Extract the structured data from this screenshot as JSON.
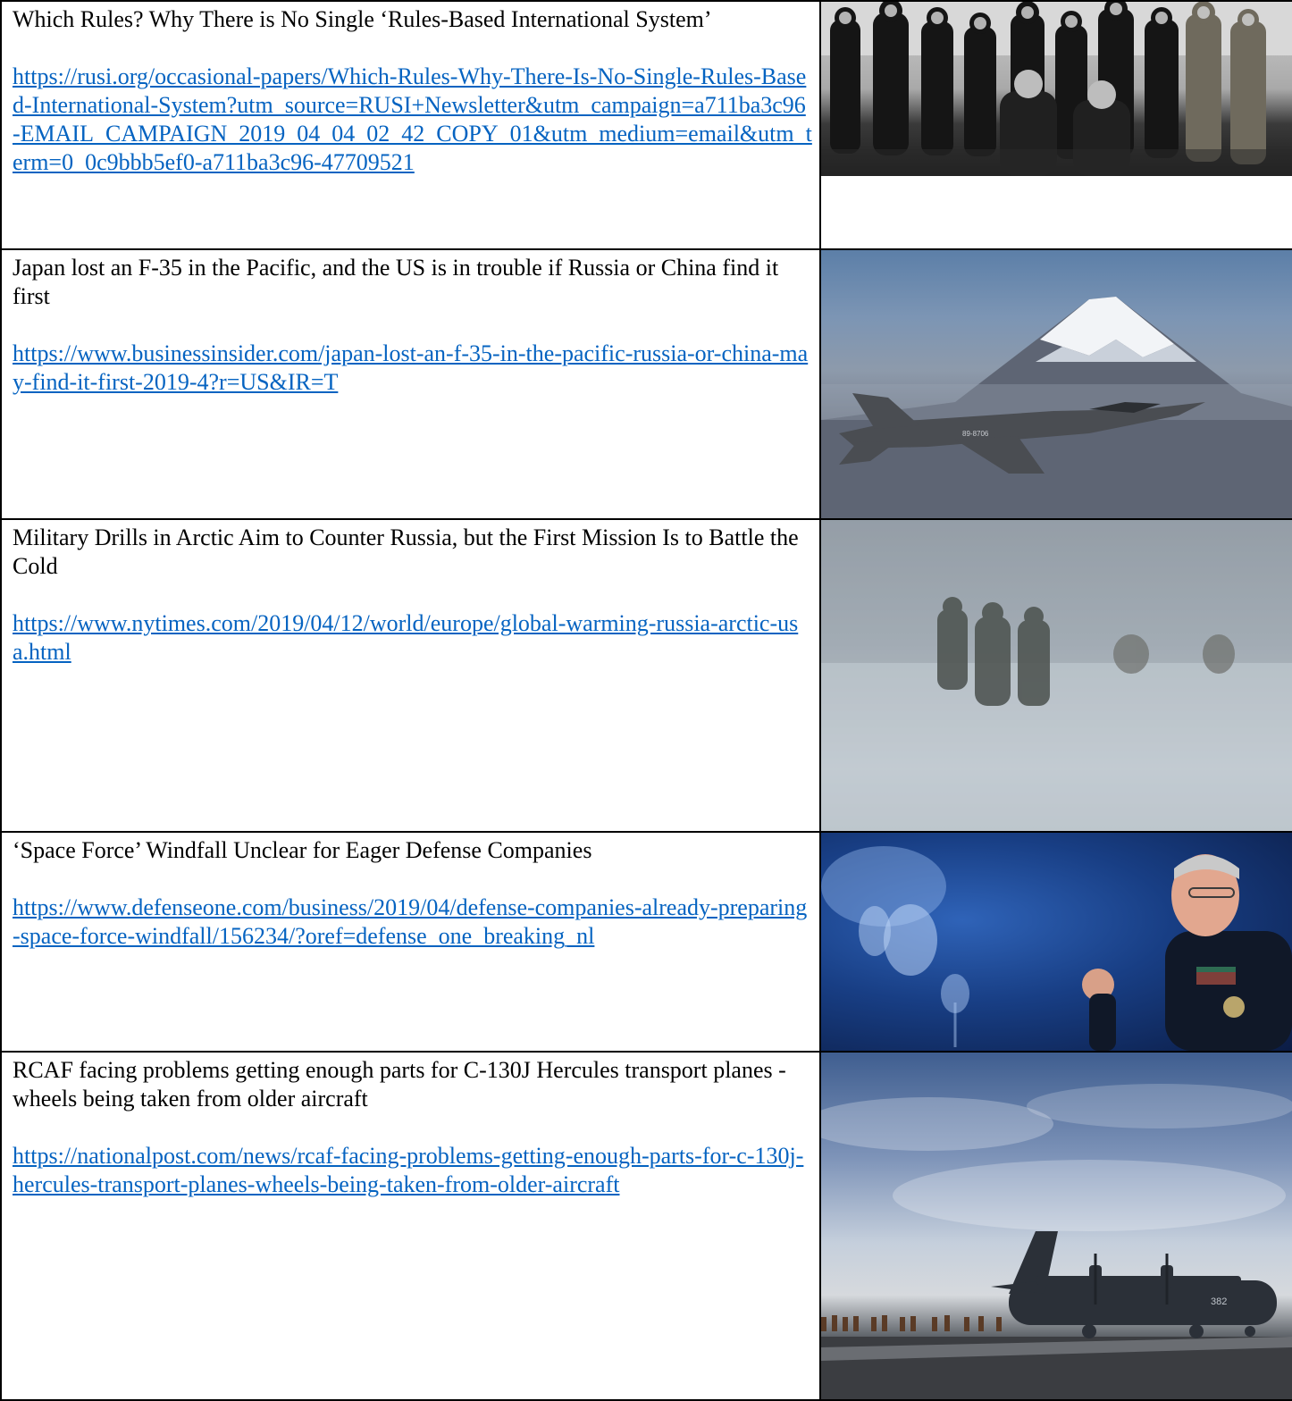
{
  "articles": [
    {
      "title": "Which Rules? Why There is No Single ‘Rules-Based International System’",
      "url": "https://rusi.org/occasional-papers/Which-Rules-Why-There-Is-No-Single-Rules-Based-International-System?utm_source=RUSI+Newsletter&utm_campaign=a711ba3c96-EMAIL_CAMPAIGN_2019_04_04_02_42_COPY_01&utm_medium=email&utm_term=0_0c9bbb5ef0-a711ba3c96-47709521",
      "image": "group-photo"
    },
    {
      "title": "Japan lost an F-35 in the Pacific, and the US is in trouble if Russia or China find it first",
      "url": "https://www.businessinsider.com/japan-lost-an-f-35-in-the-pacific-russia-or-china-may-find-it-first-2019-4?r=US&IR=T",
      "image": "fighter-jet-photo",
      "image_text": "89-8706"
    },
    {
      "title": "Military Drills in Arctic Aim to Counter Russia, but the First Mission Is to Battle the Cold",
      "url": "https://www.nytimes.com/2019/04/12/world/europe/global-warming-russia-arctic-usa.html",
      "image": "arctic-soldiers-photo"
    },
    {
      "title": "‘Space Force’ Windfall Unclear for Eager Defense Companies",
      "url": "https://www.defenseone.com/business/2019/04/defense-companies-already-preparing-space-force-windfall/156234/?oref=defense_one_breaking_nl",
      "image": "general-speaking-photo"
    },
    {
      "title": "RCAF facing problems getting enough parts for C-130J Hercules transport planes - wheels being taken from older aircraft",
      "url": "https://nationalpost.com/news/rcaf-facing-problems-getting-enough-parts-for-c-130j-hercules-transport-planes-wheels-being-taken-from-older-aircraft",
      "image": "transport-plane-photo",
      "image_text": "382"
    }
  ],
  "colors": {
    "link": "#0563C1",
    "border": "#000000",
    "text": "#000000"
  }
}
